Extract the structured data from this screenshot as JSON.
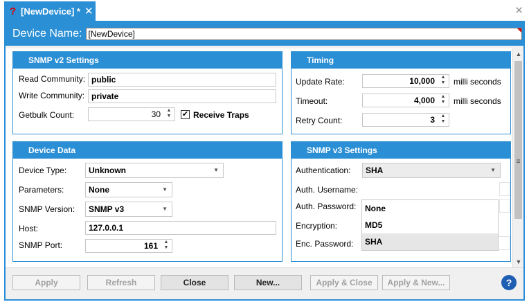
{
  "tab": {
    "title": "[NewDevice] *",
    "close_icon": "close-icon",
    "warning_icon": "question-mark-icon"
  },
  "window": {
    "close_icon": "close-icon"
  },
  "device_name": {
    "label": "Device Name:",
    "value": "[NewDevice]"
  },
  "snmp_v2": {
    "title": "SNMP v2 Settings",
    "read_community_label": "Read Community:",
    "read_community_value": "public",
    "write_community_label": "Write Community:",
    "write_community_value": "private",
    "getbulk_label": "Getbulk Count:",
    "getbulk_value": "30",
    "receive_traps_label": "Receive Traps",
    "receive_traps_checked": true
  },
  "timing": {
    "title": "Timing",
    "update_rate_label": "Update Rate:",
    "update_rate_value": "10,000",
    "update_rate_unit": "milli seconds",
    "timeout_label": "Timeout:",
    "timeout_value": "4,000",
    "timeout_unit": "milli seconds",
    "retry_label": "Retry Count:",
    "retry_value": "3"
  },
  "device_data": {
    "title": "Device Data",
    "device_type_label": "Device Type:",
    "device_type_value": "Unknown",
    "parameters_label": "Parameters:",
    "parameters_value": "None",
    "snmp_version_label": "SNMP Version:",
    "snmp_version_value": "SNMP v3",
    "host_label": "Host:",
    "host_value": "127.0.0.1",
    "snmp_port_label": "SNMP Port:",
    "snmp_port_value": "161"
  },
  "snmp_v3": {
    "title": "SNMP v3 Settings",
    "authentication_label": "Authentication:",
    "authentication_value": "SHA",
    "auth_username_label": "Auth. Username:",
    "auth_password_label": "Auth. Password:",
    "encryption_label": "Encryption:",
    "enc_password_label": "Enc. Password:",
    "dropdown_options": [
      "None",
      "MD5",
      "SHA"
    ],
    "dropdown_selected": "SHA"
  },
  "buttons": {
    "apply": "Apply",
    "refresh": "Refresh",
    "close": "Close",
    "new": "New...",
    "apply_close": "Apply & Close",
    "apply_new": "Apply & New...",
    "help": "?"
  },
  "colors": {
    "accent": "#2b8fd6",
    "warning": "#d80000",
    "help": "#1e5fb3"
  }
}
